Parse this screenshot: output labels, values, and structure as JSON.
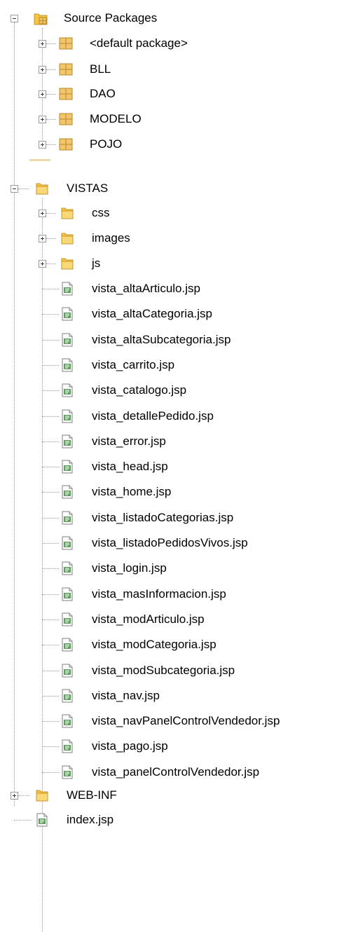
{
  "tree": {
    "source_packages": {
      "label": "Source Packages",
      "expanded": true,
      "children": [
        {
          "label": "<default package>",
          "type": "package"
        },
        {
          "label": "BLL",
          "type": "package"
        },
        {
          "label": "DAO",
          "type": "package"
        },
        {
          "label": "MODELO",
          "type": "package"
        },
        {
          "label": "POJO",
          "type": "package"
        }
      ]
    },
    "vistas": {
      "label": "VISTAS",
      "expanded": true,
      "folders": [
        {
          "label": "css"
        },
        {
          "label": "images"
        },
        {
          "label": "js"
        }
      ],
      "files": [
        {
          "label": "vista_altaArticulo.jsp"
        },
        {
          "label": "vista_altaCategoria.jsp"
        },
        {
          "label": "vista_altaSubcategoria.jsp"
        },
        {
          "label": "vista_carrito.jsp"
        },
        {
          "label": "vista_catalogo.jsp"
        },
        {
          "label": "vista_detallePedido.jsp"
        },
        {
          "label": "vista_error.jsp"
        },
        {
          "label": "vista_head.jsp"
        },
        {
          "label": "vista_home.jsp"
        },
        {
          "label": "vista_listadoCategorias.jsp"
        },
        {
          "label": "vista_listadoPedidosVivos.jsp"
        },
        {
          "label": "vista_login.jsp"
        },
        {
          "label": "vista_masInformacion.jsp"
        },
        {
          "label": "vista_modArticulo.jsp"
        },
        {
          "label": "vista_modCategoria.jsp"
        },
        {
          "label": "vista_modSubcategoria.jsp"
        },
        {
          "label": "vista_nav.jsp"
        },
        {
          "label": "vista_navPanelControlVendedor.jsp"
        },
        {
          "label": "vista_pago.jsp"
        },
        {
          "label": "vista_panelControlVendedor.jsp"
        }
      ]
    },
    "web_inf": {
      "label": "WEB-INF",
      "expanded": false
    },
    "index_file": {
      "label": "index.jsp"
    }
  },
  "colors": {
    "package_fill": "#f2c46b",
    "package_stroke": "#b88a2e",
    "folder_fill": "#f5c542",
    "folder_stroke": "#c7962a",
    "jsp_accent": "#3e8e3e",
    "tree_line": "#9a9a9a"
  }
}
